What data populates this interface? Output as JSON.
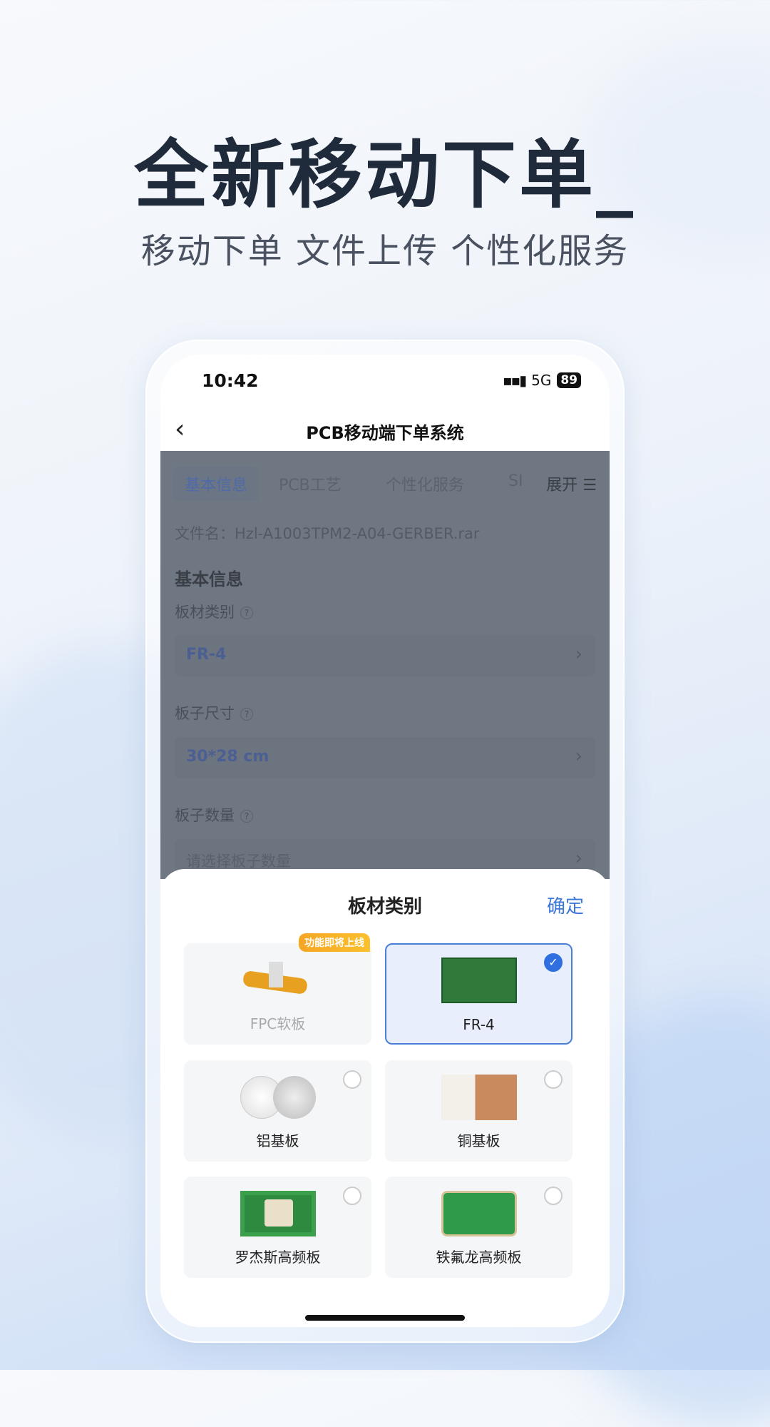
{
  "hero": {
    "title": "全新移动下单_",
    "subtitle": "移动下单 文件上传 个性化服务"
  },
  "status": {
    "time": "10:42",
    "network": "5G",
    "battery": "89"
  },
  "nav": {
    "title": "PCB移动端下单系统"
  },
  "tabs": [
    "基本信息",
    "PCB工艺",
    "个性化服务",
    "SI"
  ],
  "tabs_more": "展开 ☰",
  "file_name": "文件名：Hzl-A1003TPM2-A04-GERBER.rar",
  "section_title": "基本信息",
  "fields": [
    {
      "label": "板材类别",
      "value": "FR-4"
    },
    {
      "label": "板子尺寸",
      "value": "30*28 cm"
    },
    {
      "label": "板子数量",
      "placeholder": "请选择板子数量"
    }
  ],
  "help_glyph": "?",
  "chevron_glyph": "›",
  "sheet": {
    "title": "板材类别",
    "confirm": "确定",
    "options": [
      {
        "label": "FPC软板",
        "badge": "功能即将上线",
        "disabled": true
      },
      {
        "label": "FR-4",
        "selected": true
      },
      {
        "label": "铝基板"
      },
      {
        "label": "铜基板"
      },
      {
        "label": "罗杰斯高频板"
      },
      {
        "label": "铁氟龙高频板"
      }
    ]
  },
  "colors": {
    "accent": "#3b78d8",
    "selected_bg": "#e8eefc",
    "overlay": "#6f7782",
    "badge": "#f5a623"
  }
}
